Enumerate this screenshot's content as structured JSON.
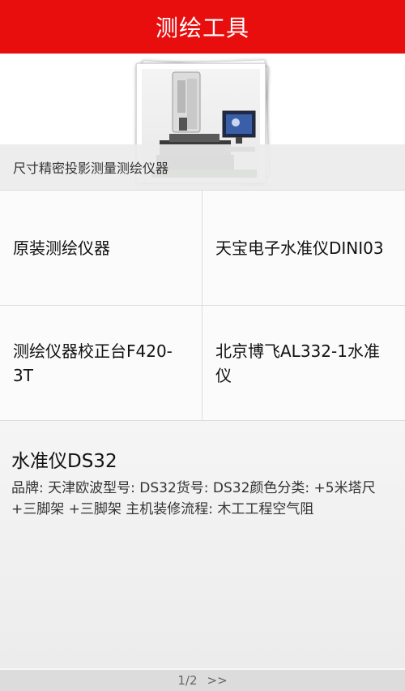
{
  "header": {
    "title": "测绘工具"
  },
  "banner": {
    "caption": "尺寸精密投影测量测绘仪器",
    "image": "measuring-instrument-photo"
  },
  "grid": {
    "items": [
      {
        "label": "原装测绘仪器"
      },
      {
        "label": "天宝电子水准仪DINI03"
      },
      {
        "label": "测绘仪器校正台F420-3T"
      },
      {
        "label": "北京博飞AL332-1水准仪"
      }
    ]
  },
  "detail": {
    "title": "水准仪DS32",
    "description": "品牌: 天津欧波型号: DS32货号: DS32颜色分类: +5米塔尺+三脚架 +三脚架 主机装修流程: 木工工程空气阻"
  },
  "pager": {
    "page": "1/2",
    "next": ">>"
  },
  "colors": {
    "header_bg": "#e90e0e",
    "header_text": "#ffffff"
  }
}
